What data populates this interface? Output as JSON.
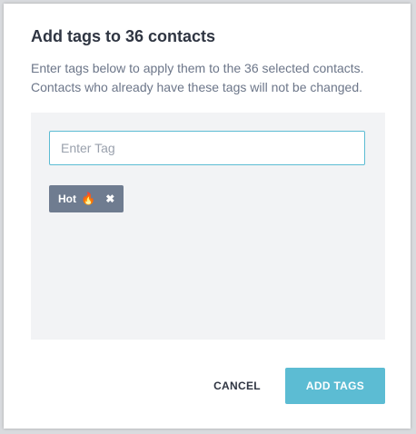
{
  "dialog": {
    "title": "Add tags to 36 contacts",
    "description": "Enter tags below to apply them to the 36 selected contacts. Contacts who already have these tags will not be changed."
  },
  "tag_input": {
    "value": "",
    "placeholder": "Enter Tag"
  },
  "tags": [
    {
      "label": "Hot",
      "emoji": "🔥",
      "remove_icon": "close-icon"
    }
  ],
  "buttons": {
    "cancel_label": "CANCEL",
    "add_label": "ADD TAGS"
  },
  "colors": {
    "accent": "#5cbcd3",
    "tag_background": "#6f7c90",
    "panel_background": "#f2f3f5",
    "title_text": "#2f3542",
    "description_text": "#6c7689"
  }
}
